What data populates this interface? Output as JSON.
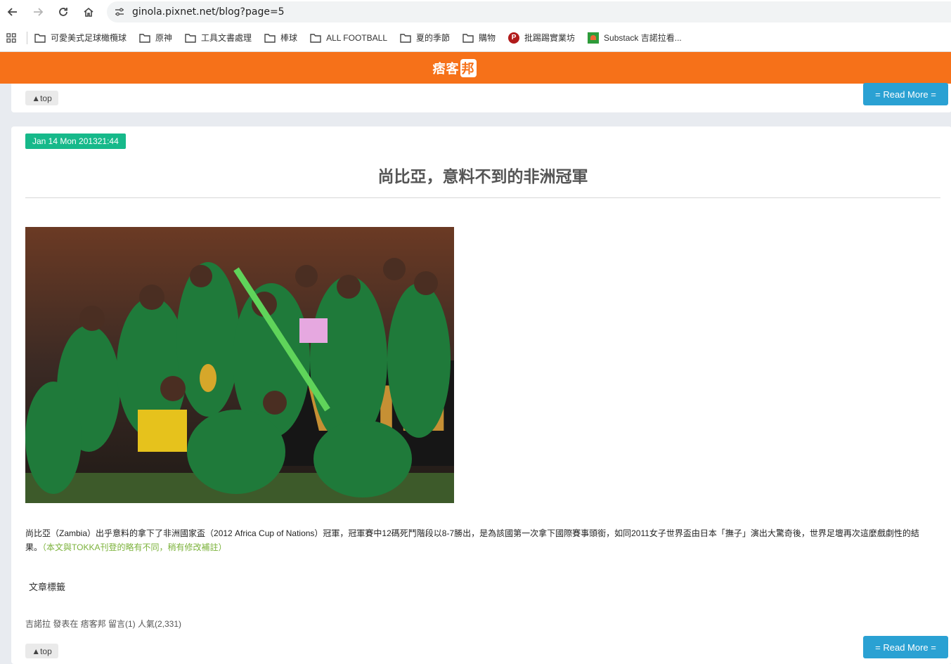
{
  "browser": {
    "url": "ginola.pixnet.net/blog?page=5",
    "bookmarks": [
      {
        "label": "可愛美式足球橄欖球",
        "icon": "folder-icon"
      },
      {
        "label": "原神",
        "icon": "folder-icon"
      },
      {
        "label": "工具文書處理",
        "icon": "folder-icon"
      },
      {
        "label": "棒球",
        "icon": "folder-icon"
      },
      {
        "label": "ALL FOOTBALL",
        "icon": "folder-icon"
      },
      {
        "label": "夏的季節",
        "icon": "folder-icon"
      },
      {
        "label": "購物",
        "icon": "folder-icon"
      },
      {
        "label": "批踢踢實業坊",
        "icon": "pixnet-icon"
      },
      {
        "label": "Substack 吉諾拉看...",
        "icon": "substack-icon"
      }
    ]
  },
  "site": {
    "logo_text": "痞客",
    "logo_box": "邦",
    "brand_color": "#f67119"
  },
  "previous_post": {
    "top_label": "▲top",
    "read_more_label": "= Read More ="
  },
  "post": {
    "date": "Jan 14 Mon 201321:44",
    "title": "尚比亞，意料不到的非洲冠軍",
    "body": "尚比亞（Zambia）出乎意料的拿下了非洲國家盃（2012 Africa Cup of Nations）冠軍，冠軍賽中12碼死鬥階段以8-7勝出，是為該國第一次拿下國際賽事頭銜，如同2011女子世界盃由日本「撫子」演出大驚奇後，世界足壇再次這麼戲劇性的結果。",
    "note_open": "（",
    "note": "本文與TOKKA刊登的略有不同，稍有修改補註",
    "note_close": "）",
    "tags_label": "文章標籤",
    "meta": "吉諾拉 發表在 痞客邦 留言(1) 人氣(2,331)",
    "top_label": "▲top",
    "read_more_label": "= Read More ="
  }
}
